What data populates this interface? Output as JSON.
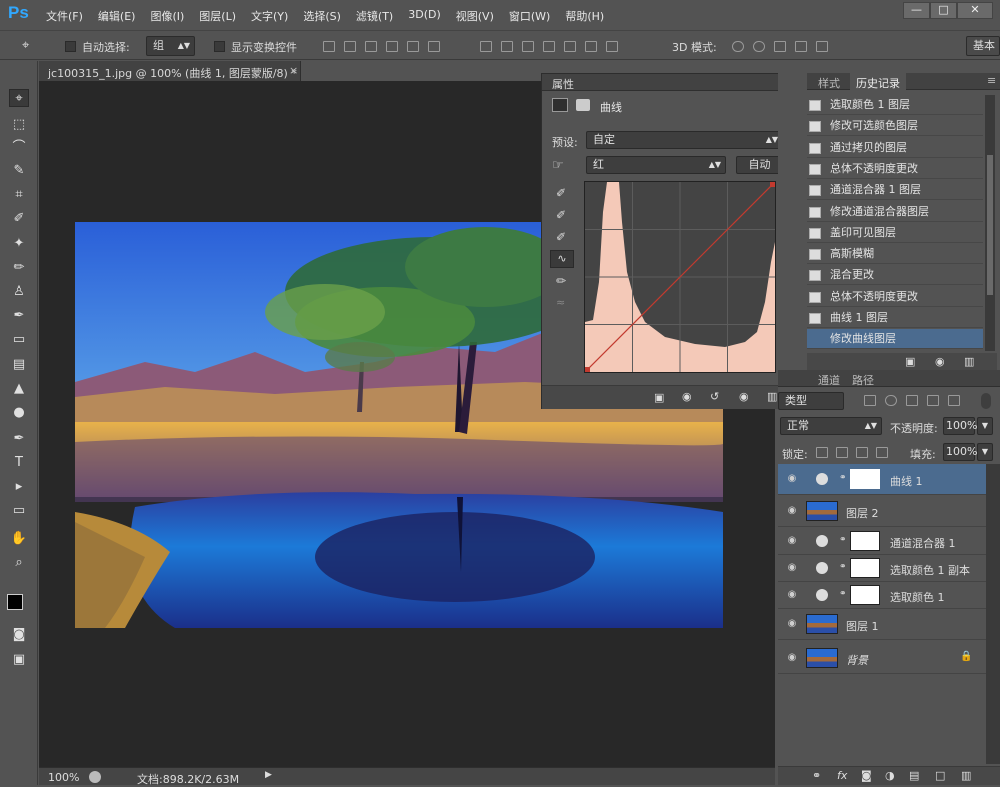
{
  "app": {
    "logo": "Ps",
    "menu": [
      "文件(F)",
      "编辑(E)",
      "图像(I)",
      "图层(L)",
      "文字(Y)",
      "选择(S)",
      "滤镜(T)",
      "3D(D)",
      "视图(V)",
      "窗口(W)",
      "帮助(H)"
    ],
    "win_min": "—",
    "win_max": "□",
    "win_close": "✕"
  },
  "options": {
    "auto_select_label": "自动选择:",
    "auto_select_value": "组",
    "show_transform_label": "显示变换控件",
    "mode_3d_label": "3D 模式:",
    "workspace": "基本"
  },
  "document": {
    "tab_title": "jc100315_1.jpg @ 100% (曲线 1, 图层蒙版/8) *",
    "tab_close": "×",
    "zoom": "100%",
    "doc_info": "文档:898.2K/2.63M"
  },
  "properties": {
    "panel_title": "属性",
    "adj_name": "曲线",
    "preset_label": "预设:",
    "preset_value": "自定",
    "channel_value": "红",
    "auto_button": "自动"
  },
  "history": {
    "tab_styles": "样式",
    "tab_history": "历史记录",
    "items": [
      "选取颜色 1 图层",
      "修改可选颜色图层",
      "通过拷贝的图层",
      "总体不透明度更改",
      "通道混合器 1 图层",
      "修改通道混合器图层",
      "盖印可见图层",
      "高斯模糊",
      "混合更改",
      "总体不透明度更改",
      "曲线 1 图层",
      "修改曲线图层"
    ]
  },
  "layers_panel": {
    "tab_channels": "通道",
    "tab_paths": "路径",
    "kind_label": "类型",
    "blend_mode": "正常",
    "opacity_label": "不透明度:",
    "opacity_value": "100%",
    "lock_label": "锁定:",
    "fill_label": "填充:",
    "fill_value": "100%",
    "layers": [
      {
        "name": "曲线 1"
      },
      {
        "name": "图层 2"
      },
      {
        "name": "通道混合器 1"
      },
      {
        "name": "选取颜色 1 副本"
      },
      {
        "name": "选取颜色 1"
      },
      {
        "name": "图层 1"
      },
      {
        "name": "背景"
      }
    ]
  },
  "curve": {
    "channel": "红",
    "points": [
      [
        0,
        0
      ],
      [
        255,
        255
      ]
    ]
  },
  "colors": {
    "accent": "#31a8ff",
    "selected_row": "#4b6b8f",
    "curve_line": "#c23a2f",
    "histogram_fill": "#f4c9b8"
  }
}
